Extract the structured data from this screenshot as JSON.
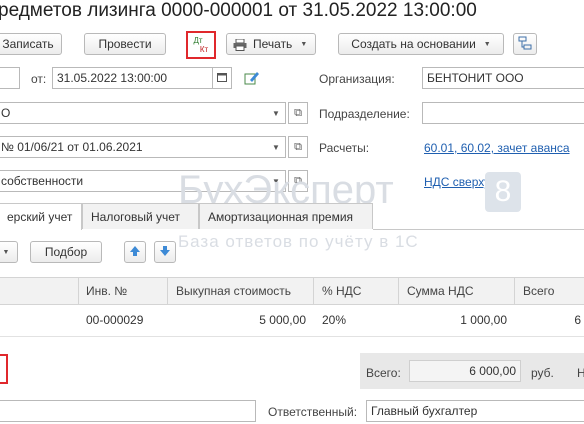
{
  "title": "редметов лизинга 0000-000001 от 31.05.2022 13:00:00",
  "toolbar": {
    "save_label": "Записать",
    "post_label": "Провести",
    "dtkt_top": "Дт",
    "dtkt_bottom": "Кт",
    "print_label": "Печать",
    "create_based_label": "Создать на основании"
  },
  "header": {
    "date_label": "от:",
    "date_value": "31.05.2022 13:00:00",
    "org_label": "Организация:",
    "org_value": "БЕНТОНИТ ООО",
    "row2_value": "О",
    "dept_label": "Подразделение:",
    "dept_value": "",
    "contract_value": "№ 01/06/21 от 01.06.2021",
    "settlements_label": "Расчеты:",
    "settlements_link": "60.01, 60.02, зачет аванса",
    "ownership_value": "собственности",
    "vat_link": "НДС сверху"
  },
  "tabs": [
    "ерский учет",
    "Налоговый учет",
    "Амортизационная премия"
  ],
  "table_toolbar": {
    "select_label": "Подбор"
  },
  "table": {
    "columns": [
      "Инв. №",
      "Выкупная стоимость",
      "% НДС",
      "Сумма НДС",
      "Всего"
    ],
    "rows": [
      {
        "inv": "00-000029",
        "cost": "5 000,00",
        "vat_pct": "20%",
        "vat_sum": "1 000,00",
        "total": "6"
      }
    ]
  },
  "totals": {
    "label": "Всего:",
    "value": "6 000,00",
    "currency": "руб.",
    "extra": "Н"
  },
  "footer": {
    "responsible_label": "Ответственный:",
    "responsible_value": "Главный бухгалтер"
  },
  "watermark": {
    "brand": "БухЭксперт",
    "badge": "8",
    "tagline": "База ответов по учёту в 1С"
  },
  "colors": {
    "highlight": "#e0282c",
    "link": "#1f5fb0",
    "arrow_blue": "#3d8ad6"
  }
}
